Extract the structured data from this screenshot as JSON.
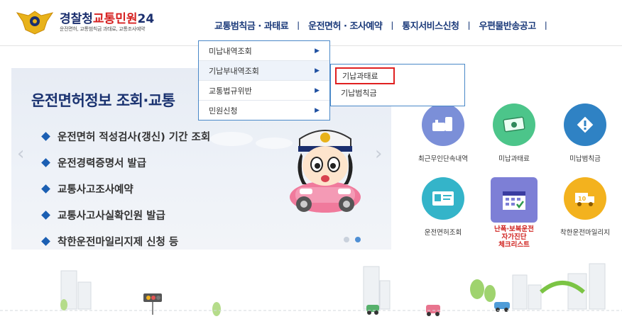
{
  "header": {
    "logo_title_part1": "경찰청",
    "logo_title_part2": "교통민원",
    "logo_title_part3": "24",
    "logo_subtitle": "운전면허, 교통범칙금 과태료, 교통조사예약",
    "nav": [
      {
        "label": "교통범칙금 · 과태료"
      },
      {
        "label": "운전면허 · 조사예약"
      },
      {
        "label": "통지서비스신청"
      },
      {
        "label": "우편물반송공고"
      }
    ],
    "nav_separator": "ㅣ"
  },
  "dropdown": {
    "items": [
      {
        "label": "미납내역조회",
        "arrow": "▶"
      },
      {
        "label": "기납부내역조회",
        "arrow": "▶"
      },
      {
        "label": "교통법규위반",
        "arrow": "▶"
      },
      {
        "label": "민원신청",
        "arrow": "▶"
      }
    ],
    "submenu": [
      {
        "label": "기납과태료"
      },
      {
        "label": "기납범칙금"
      }
    ]
  },
  "banner": {
    "title": "운전면허정보 조회·교통",
    "items": [
      {
        "label": "운전면허 적성검사(갱신) 기간 조회"
      },
      {
        "label": "운전경력증명서 발급"
      },
      {
        "label": "교통사고조사예약"
      },
      {
        "label": "교통사고사실확인원 발급"
      },
      {
        "label": "착한운전마일리지제 신청 등"
      }
    ],
    "prev_arrow": "‹",
    "next_arrow": "›",
    "slide_total": 2,
    "slide_active": 2
  },
  "services": [
    {
      "label": "최근무인단속내역",
      "icon": "camera-icon",
      "color": "#7b8fd8"
    },
    {
      "label": "미납과태료",
      "icon": "money-icon",
      "color": "#4cc58a"
    },
    {
      "label": "미납범칙금",
      "icon": "warning-sign-icon",
      "color": "#2f82c4"
    },
    {
      "label": "운전면허조회",
      "icon": "license-card-icon",
      "color": "#34b4c9"
    },
    {
      "label_lines": [
        "난폭·보복운전",
        "자가진단",
        "체크리스트"
      ],
      "icon": "calendar-check-icon",
      "color": "#7d7fd6"
    },
    {
      "label": "착한운전마일리지",
      "icon": "truck-icon",
      "color": "#f3b21e"
    }
  ],
  "colors": {
    "brand_navy": "#1b2f6e",
    "brand_red": "#d62020",
    "menu_border": "#4a88c8",
    "highlight_red": "#e02020"
  }
}
